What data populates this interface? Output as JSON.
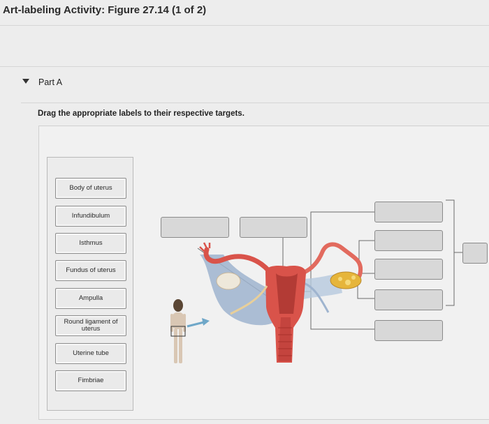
{
  "header": {
    "title": "Art-labeling Activity: Figure 27.14 (1 of 2)"
  },
  "part": {
    "label": "Part A"
  },
  "instructions": "Drag the appropriate labels to their respective targets.",
  "labels": [
    "Body of uterus",
    "Infundibulum",
    "Isthmus",
    "Fundus of uterus",
    "Ampulla",
    "Round ligament of uterus",
    "Uterine tube",
    "Fimbriae"
  ],
  "colors": {
    "uterus": "#d9534a",
    "tube": "#e26a5e",
    "ligament": "#9fb4cf",
    "ovary": "#e6b53b",
    "arrow": "#6fa7c8"
  }
}
